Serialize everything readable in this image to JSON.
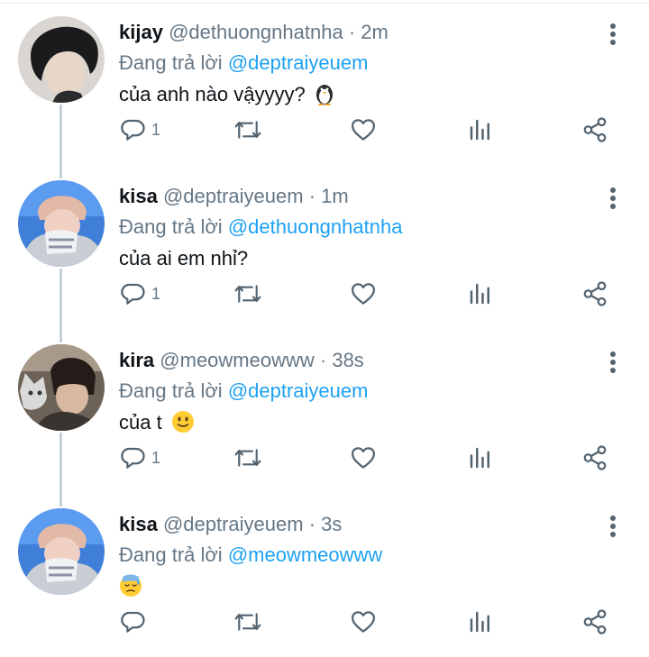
{
  "thread": {
    "tweets": [
      {
        "name": "kijay",
        "handle": "@dethuongnhatnha",
        "time": "· 2m",
        "reply_prefix": "Đang trả lời",
        "reply_to": "@deptraiyeuem",
        "text": "của anh nào vậyyyy?",
        "emoji": "penguin-emoji",
        "reply_count": "1",
        "avatar": "avatar-kijay"
      },
      {
        "name": "kisa",
        "handle": "@deptraiyeuem",
        "time": "· 1m",
        "reply_prefix": "Đang trả lời",
        "reply_to": "@dethuongnhatnha",
        "text": "của ai em nhỉ?",
        "emoji": "",
        "reply_count": "1",
        "avatar": "avatar-kisa"
      },
      {
        "name": "kira",
        "handle": "@meowmeowww",
        "time": "· 38s",
        "reply_prefix": "Đang trả lời",
        "reply_to": "@deptraiyeuem",
        "text": "của t",
        "emoji": "slight-smile-emoji",
        "reply_count": "1",
        "avatar": "avatar-kira"
      },
      {
        "name": "kisa",
        "handle": "@deptraiyeuem",
        "time": "· 3s",
        "reply_prefix": "Đang trả lời",
        "reply_to": "@meowmeowww",
        "text": "",
        "emoji": "downcast-sweat-emoji",
        "reply_count": "",
        "avatar": "avatar-kisa"
      }
    ]
  },
  "icons": {
    "reply": "reply-icon",
    "retweet": "retweet-icon",
    "like": "heart-icon",
    "stats": "analytics-icon",
    "share": "share-icon",
    "more": "more-vertical-icon"
  },
  "colors": {
    "mention": "#1da1f2",
    "secondary_text": "#657786",
    "icon": "#536471",
    "thread_line": "#c4cfd6"
  }
}
